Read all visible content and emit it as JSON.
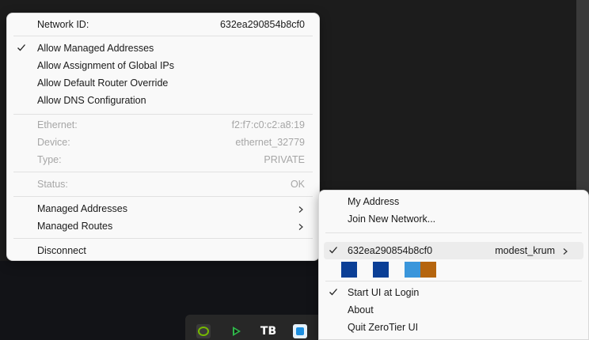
{
  "network_menu": {
    "network_id_label": "Network ID:",
    "network_id_value": "632ea290854b8cf0",
    "options": [
      {
        "label": "Allow Managed Addresses",
        "checked": true
      },
      {
        "label": "Allow Assignment of Global IPs",
        "checked": false
      },
      {
        "label": "Allow Default Router Override",
        "checked": false
      },
      {
        "label": "Allow DNS Configuration",
        "checked": false
      }
    ],
    "info": {
      "ethernet_label": "Ethernet:",
      "ethernet_value": "f2:f7:c0:c2:a8:19",
      "device_label": "Device:",
      "device_value": "ethernet_32779",
      "type_label": "Type:",
      "type_value": "PRIVATE",
      "status_label": "Status:",
      "status_value": "OK"
    },
    "submenus": [
      {
        "label": "Managed Addresses"
      },
      {
        "label": "Managed Routes"
      }
    ],
    "disconnect_label": "Disconnect"
  },
  "tray_menu": {
    "my_address_label": "My Address",
    "join_label": "Join New Network...",
    "network_item": {
      "id": "632ea290854b8cf0",
      "name": "modest_krum",
      "checked": true
    },
    "swatch_colors": [
      "#0b3f96",
      "#0b3f96",
      "#3a96db",
      "#b5650e"
    ],
    "start_ui_label": "Start UI at Login",
    "about_label": "About",
    "quit_label": "Quit ZeroTier UI"
  },
  "taskbar": {
    "icons": [
      "nvidia-icon",
      "play-icon",
      "tb-icon",
      "zerotier-icon"
    ],
    "tb_glyph": "TB"
  },
  "colors": {
    "menu_bg": "#f9f9f9",
    "disabled_text": "#a6a6a6",
    "highlight": "#ececec",
    "desktop": "#1c1c1c"
  }
}
